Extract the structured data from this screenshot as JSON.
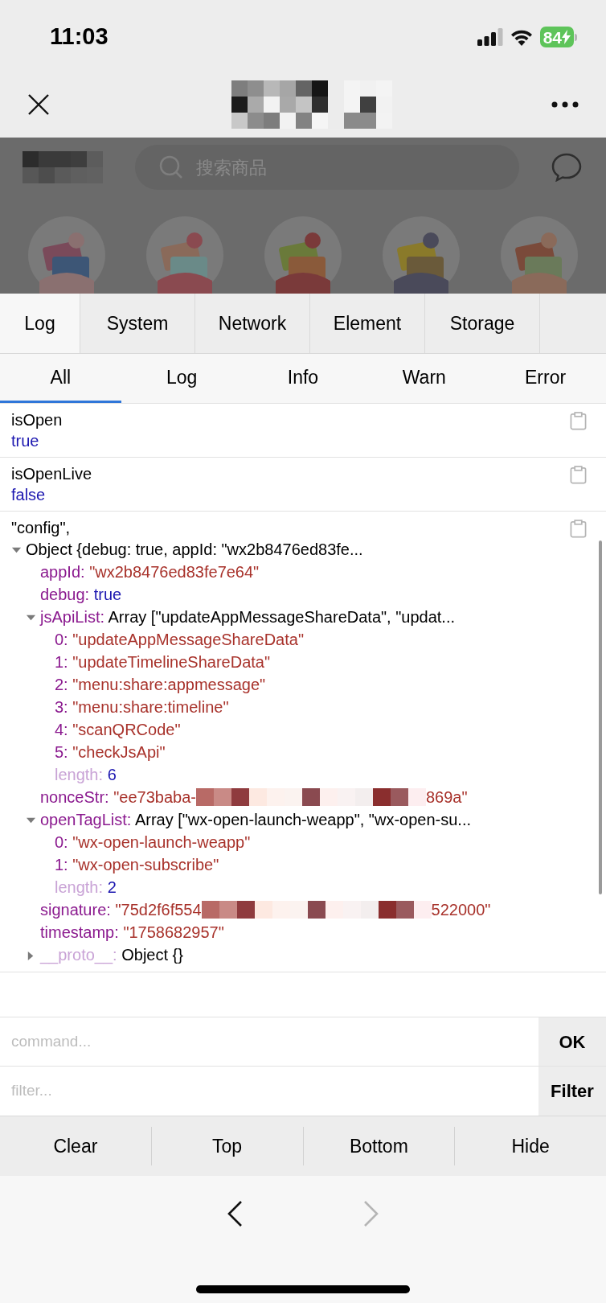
{
  "status_bar": {
    "time": "11:03",
    "battery": "84"
  },
  "web_page": {
    "search": {
      "placeholder": "搜索商品"
    }
  },
  "tabs": [
    {
      "label": "Log",
      "selected": true
    },
    {
      "label": "System",
      "selected": false
    },
    {
      "label": "Network",
      "selected": false
    },
    {
      "label": "Element",
      "selected": false
    },
    {
      "label": "Storage",
      "selected": false
    }
  ],
  "filter_tabs": [
    {
      "label": "All",
      "selected": true
    },
    {
      "label": "Log",
      "selected": false
    },
    {
      "label": "Info",
      "selected": false
    },
    {
      "label": "Warn",
      "selected": false
    },
    {
      "label": "Error",
      "selected": false
    }
  ],
  "log_entries": [
    {
      "kind": "value",
      "label": "isOpen",
      "value": "true"
    },
    {
      "kind": "value",
      "label": "isOpenLive",
      "value": "false"
    },
    {
      "kind": "tree",
      "label": "\"config\",",
      "root": {
        "summary": "Object {debug: true, appId: \"wx2b8476ed83fe...",
        "expanded": true,
        "children": [
          {
            "kind": "property",
            "key": "appId:",
            "value": {
              "kind": "string",
              "text": "\"wx2b8476ed83fe7e64\""
            }
          },
          {
            "kind": "property",
            "key": "debug:",
            "value": {
              "kind": "literal",
              "text": "true"
            }
          },
          {
            "kind": "property",
            "key": "jsApiList:",
            "value": {
              "kind": "summary",
              "text": "Array [\"updateAppMessageShareData\", \"updat..."
            },
            "expanded": true,
            "children": [
              {
                "kind": "property",
                "key": "0:",
                "value": {
                  "kind": "string",
                  "text": "\"updateAppMessageShareData\""
                }
              },
              {
                "kind": "property",
                "key": "1:",
                "value": {
                  "kind": "string",
                  "text": "\"updateTimelineShareData\""
                }
              },
              {
                "kind": "property",
                "key": "2:",
                "value": {
                  "kind": "string",
                  "text": "\"menu:share:appmessage\""
                }
              },
              {
                "kind": "property",
                "key": "3:",
                "value": {
                  "kind": "string",
                  "text": "\"menu:share:timeline\""
                }
              },
              {
                "kind": "property",
                "key": "4:",
                "value": {
                  "kind": "string",
                  "text": "\"scanQRCode\""
                }
              },
              {
                "kind": "property",
                "key": "5:",
                "value": {
                  "kind": "string",
                  "text": "\"checkJsApi\""
                }
              },
              {
                "kind": "meta",
                "key": "length:",
                "value": {
                  "kind": "literal",
                  "text": "6"
                }
              }
            ]
          },
          {
            "kind": "property",
            "key": "nonceStr:",
            "value": {
              "kind": "redacted",
              "text": "\"ee73baba-",
              "text_end": "869a\""
            }
          },
          {
            "kind": "property",
            "key": "openTagList:",
            "value": {
              "kind": "summary",
              "text": "Array [\"wx-open-launch-weapp\", \"wx-open-su..."
            },
            "expanded": true,
            "children": [
              {
                "kind": "property",
                "key": "0:",
                "value": {
                  "kind": "string",
                  "text": "\"wx-open-launch-weapp\""
                }
              },
              {
                "kind": "property",
                "key": "1:",
                "value": {
                  "kind": "string",
                  "text": "\"wx-open-subscribe\""
                }
              },
              {
                "kind": "meta",
                "key": "length:",
                "value": {
                  "kind": "literal",
                  "text": "2"
                }
              }
            ]
          },
          {
            "kind": "property",
            "key": "signature:",
            "value": {
              "kind": "redacted",
              "text": "\"75d2f6f554",
              "text_end": "522000\""
            }
          },
          {
            "kind": "property",
            "key": "timestamp:",
            "value": {
              "kind": "string",
              "text": "\"1758682957\""
            }
          },
          {
            "kind": "meta",
            "key": "__proto__:",
            "value": {
              "kind": "summary",
              "text": "Object {}"
            },
            "expanded": false
          }
        ]
      }
    }
  ],
  "command": {
    "placeholder": "command...",
    "button": "OK"
  },
  "filter": {
    "placeholder": "filter...",
    "button": "Filter"
  },
  "toolbar": [
    "Clear",
    "Top",
    "Bottom",
    "Hide"
  ],
  "browser_nav": {
    "back": {
      "disabled": false
    },
    "forward": {
      "disabled": true
    }
  }
}
